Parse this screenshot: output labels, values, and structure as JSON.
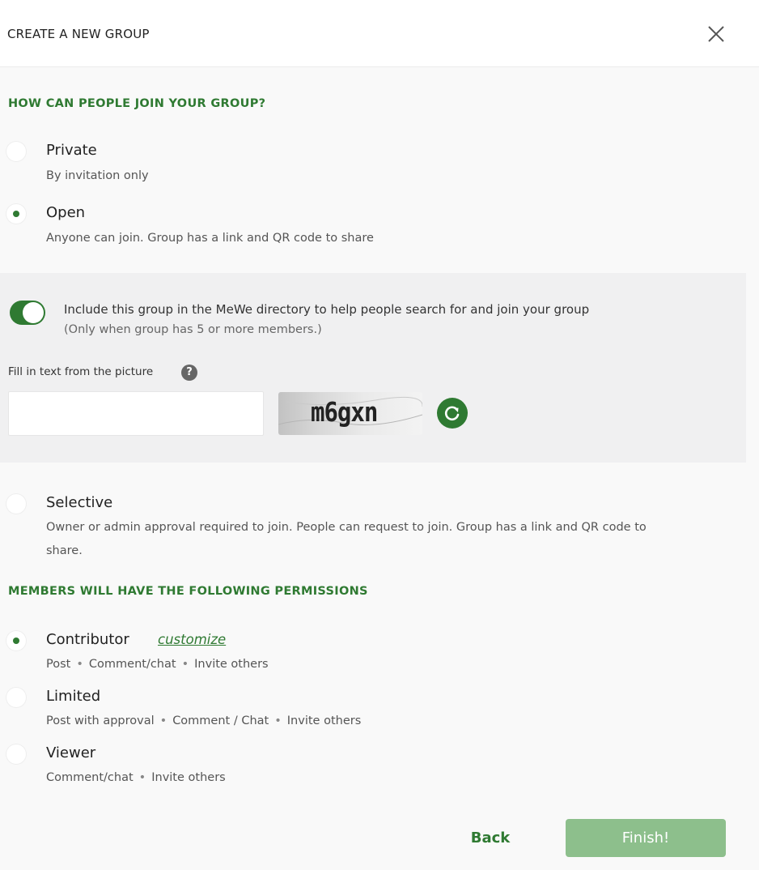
{
  "header": {
    "title": "CREATE A NEW GROUP"
  },
  "join": {
    "heading": "HOW CAN PEOPLE JOIN YOUR GROUP?",
    "options": [
      {
        "label": "Private",
        "desc": "By invitation only",
        "checked": false
      },
      {
        "label": "Open",
        "desc": "Anyone can join. Group has a link and QR code to share",
        "checked": true
      },
      {
        "label": "Selective",
        "desc_line1": "Owner or admin approval required to join. People can request to join. Group has a link and QR code to",
        "desc_line2": "share.",
        "checked": false
      }
    ]
  },
  "directory": {
    "toggle_on": true,
    "text": "Include this group in the MeWe directory to help people search for and join your group",
    "note": "(Only when group has 5 or more members.)"
  },
  "captcha": {
    "label": "Fill in text from the picture",
    "help_icon": "?",
    "input_value": "",
    "image_text": "m6gxn"
  },
  "permissions": {
    "heading": "MEMBERS WILL HAVE THE FOLLOWING PERMISSIONS",
    "customize": "customize",
    "options": [
      {
        "label": "Contributor",
        "items": [
          "Post",
          "Comment/chat",
          "Invite others"
        ],
        "checked": true
      },
      {
        "label": "Limited",
        "items": [
          "Post with approval",
          "Comment / Chat",
          "Invite others"
        ],
        "checked": false
      },
      {
        "label": "Viewer",
        "items": [
          "Comment/chat",
          "Invite others"
        ],
        "checked": false
      }
    ]
  },
  "footer": {
    "back": "Back",
    "finish": "Finish!"
  },
  "colors": {
    "accent": "#2f7a32",
    "finish_disabled": "#8dbf8c",
    "panel": "#f0f0f1"
  }
}
